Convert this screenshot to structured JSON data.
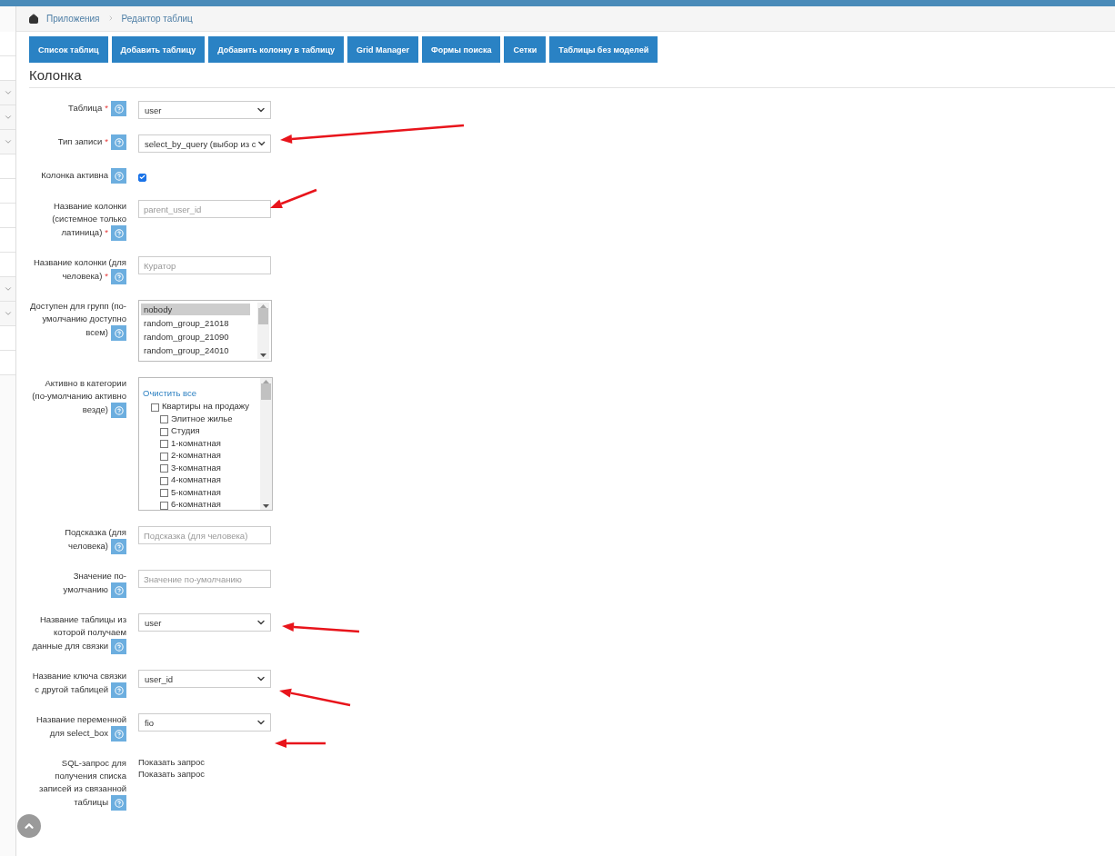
{
  "sidebar": {
    "items": [
      {
        "expandable": false
      },
      {
        "expandable": false
      },
      {
        "expandable": true
      },
      {
        "expandable": true
      },
      {
        "expandable": true
      },
      {
        "expandable": false
      },
      {
        "expandable": false
      },
      {
        "expandable": false
      },
      {
        "expandable": false
      },
      {
        "expandable": false
      },
      {
        "expandable": true
      },
      {
        "expandable": true
      },
      {
        "expandable": false
      },
      {
        "expandable": false
      }
    ]
  },
  "breadcrumbs": [
    "Приложения",
    "Редактор таблиц"
  ],
  "toolbar": [
    "Список таблиц",
    "Добавить таблицу",
    "Добавить колонку в таблицу",
    "Grid Manager",
    "Формы поиска",
    "Сетки",
    "Таблицы без моделей"
  ],
  "heading": "Колонка",
  "fields": [
    {
      "label": "Таблица",
      "mark": "*",
      "kind": "select",
      "value": "user"
    },
    {
      "label": "Тип записи",
      "mark": "*",
      "kind": "select",
      "value": "select_by_query (выбор из с"
    },
    {
      "label": "Колонка активна",
      "kind": "checkbox",
      "checked": true
    },
    {
      "label": "Название колонки (системное только латиница)",
      "mark": "*",
      "kind": "input",
      "placeholder": "parent_user_id"
    },
    {
      "label": "Название колонки (для человека)",
      "mark": "*",
      "kind": "input",
      "placeholder": "Куратор"
    },
    {
      "label": "Доступен для групп (по-умолчанию доступно всем)",
      "kind": "listbox",
      "options": [
        {
          "text": "nobody",
          "selected": true
        },
        {
          "text": "random_group_21018",
          "selected": false
        },
        {
          "text": "random_group_21090",
          "selected": false
        },
        {
          "text": "random_group_24010",
          "selected": false
        }
      ]
    },
    {
      "label": "Активно в категории (по-умолчанию активно везде)",
      "kind": "tree",
      "clear_link": "Очистить все",
      "items": [
        {
          "text": "Квартиры на продажу",
          "checked": false,
          "children": [
            {
              "text": "Элитное жилье",
              "checked": false
            },
            {
              "text": "Студия",
              "checked": false
            },
            {
              "text": "1-комнатная",
              "checked": false
            },
            {
              "text": "2-комнатная",
              "checked": false
            },
            {
              "text": "3-комнатная",
              "checked": false
            },
            {
              "text": "4-комнатная",
              "checked": false
            },
            {
              "text": "5-комнатная",
              "checked": false
            },
            {
              "text": "6-комнатная",
              "checked": false
            }
          ]
        }
      ]
    },
    {
      "label": "Подсказка (для человека)",
      "kind": "input",
      "placeholder": "Подсказка (для человека)"
    },
    {
      "label": "Значение по-умолчанию",
      "kind": "input",
      "placeholder": "Значение по-умолчанию"
    },
    {
      "label": "Название таблицы из которой получаем данные для связки",
      "kind": "select",
      "value": "user"
    },
    {
      "label": "Название ключа связки с другой таблицей",
      "kind": "select",
      "value": "user_id"
    },
    {
      "label": "Название переменной для select_box",
      "kind": "select",
      "value": "fio"
    },
    {
      "label": "SQL-запрос для получения списка записей из связанной таблицы",
      "kind": "links",
      "links": [
        "Показать запрос",
        "Показать запрос"
      ]
    }
  ]
}
